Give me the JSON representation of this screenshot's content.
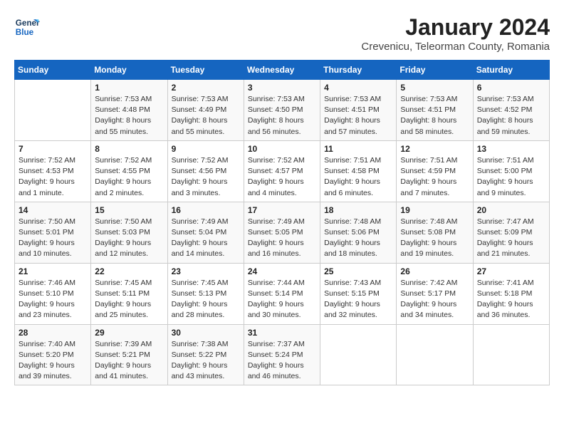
{
  "logo": {
    "line1": "General",
    "line2": "Blue"
  },
  "title": "January 2024",
  "subtitle": "Crevenicu, Teleorman County, Romania",
  "days_header": [
    "Sunday",
    "Monday",
    "Tuesday",
    "Wednesday",
    "Thursday",
    "Friday",
    "Saturday"
  ],
  "weeks": [
    [
      {
        "day": "",
        "info": ""
      },
      {
        "day": "1",
        "info": "Sunrise: 7:53 AM\nSunset: 4:48 PM\nDaylight: 8 hours\nand 55 minutes."
      },
      {
        "day": "2",
        "info": "Sunrise: 7:53 AM\nSunset: 4:49 PM\nDaylight: 8 hours\nand 55 minutes."
      },
      {
        "day": "3",
        "info": "Sunrise: 7:53 AM\nSunset: 4:50 PM\nDaylight: 8 hours\nand 56 minutes."
      },
      {
        "day": "4",
        "info": "Sunrise: 7:53 AM\nSunset: 4:51 PM\nDaylight: 8 hours\nand 57 minutes."
      },
      {
        "day": "5",
        "info": "Sunrise: 7:53 AM\nSunset: 4:51 PM\nDaylight: 8 hours\nand 58 minutes."
      },
      {
        "day": "6",
        "info": "Sunrise: 7:53 AM\nSunset: 4:52 PM\nDaylight: 8 hours\nand 59 minutes."
      }
    ],
    [
      {
        "day": "7",
        "info": "Sunrise: 7:52 AM\nSunset: 4:53 PM\nDaylight: 9 hours\nand 1 minute."
      },
      {
        "day": "8",
        "info": "Sunrise: 7:52 AM\nSunset: 4:55 PM\nDaylight: 9 hours\nand 2 minutes."
      },
      {
        "day": "9",
        "info": "Sunrise: 7:52 AM\nSunset: 4:56 PM\nDaylight: 9 hours\nand 3 minutes."
      },
      {
        "day": "10",
        "info": "Sunrise: 7:52 AM\nSunset: 4:57 PM\nDaylight: 9 hours\nand 4 minutes."
      },
      {
        "day": "11",
        "info": "Sunrise: 7:51 AM\nSunset: 4:58 PM\nDaylight: 9 hours\nand 6 minutes."
      },
      {
        "day": "12",
        "info": "Sunrise: 7:51 AM\nSunset: 4:59 PM\nDaylight: 9 hours\nand 7 minutes."
      },
      {
        "day": "13",
        "info": "Sunrise: 7:51 AM\nSunset: 5:00 PM\nDaylight: 9 hours\nand 9 minutes."
      }
    ],
    [
      {
        "day": "14",
        "info": "Sunrise: 7:50 AM\nSunset: 5:01 PM\nDaylight: 9 hours\nand 10 minutes."
      },
      {
        "day": "15",
        "info": "Sunrise: 7:50 AM\nSunset: 5:03 PM\nDaylight: 9 hours\nand 12 minutes."
      },
      {
        "day": "16",
        "info": "Sunrise: 7:49 AM\nSunset: 5:04 PM\nDaylight: 9 hours\nand 14 minutes."
      },
      {
        "day": "17",
        "info": "Sunrise: 7:49 AM\nSunset: 5:05 PM\nDaylight: 9 hours\nand 16 minutes."
      },
      {
        "day": "18",
        "info": "Sunrise: 7:48 AM\nSunset: 5:06 PM\nDaylight: 9 hours\nand 18 minutes."
      },
      {
        "day": "19",
        "info": "Sunrise: 7:48 AM\nSunset: 5:08 PM\nDaylight: 9 hours\nand 19 minutes."
      },
      {
        "day": "20",
        "info": "Sunrise: 7:47 AM\nSunset: 5:09 PM\nDaylight: 9 hours\nand 21 minutes."
      }
    ],
    [
      {
        "day": "21",
        "info": "Sunrise: 7:46 AM\nSunset: 5:10 PM\nDaylight: 9 hours\nand 23 minutes."
      },
      {
        "day": "22",
        "info": "Sunrise: 7:45 AM\nSunset: 5:11 PM\nDaylight: 9 hours\nand 25 minutes."
      },
      {
        "day": "23",
        "info": "Sunrise: 7:45 AM\nSunset: 5:13 PM\nDaylight: 9 hours\nand 28 minutes."
      },
      {
        "day": "24",
        "info": "Sunrise: 7:44 AM\nSunset: 5:14 PM\nDaylight: 9 hours\nand 30 minutes."
      },
      {
        "day": "25",
        "info": "Sunrise: 7:43 AM\nSunset: 5:15 PM\nDaylight: 9 hours\nand 32 minutes."
      },
      {
        "day": "26",
        "info": "Sunrise: 7:42 AM\nSunset: 5:17 PM\nDaylight: 9 hours\nand 34 minutes."
      },
      {
        "day": "27",
        "info": "Sunrise: 7:41 AM\nSunset: 5:18 PM\nDaylight: 9 hours\nand 36 minutes."
      }
    ],
    [
      {
        "day": "28",
        "info": "Sunrise: 7:40 AM\nSunset: 5:20 PM\nDaylight: 9 hours\nand 39 minutes."
      },
      {
        "day": "29",
        "info": "Sunrise: 7:39 AM\nSunset: 5:21 PM\nDaylight: 9 hours\nand 41 minutes."
      },
      {
        "day": "30",
        "info": "Sunrise: 7:38 AM\nSunset: 5:22 PM\nDaylight: 9 hours\nand 43 minutes."
      },
      {
        "day": "31",
        "info": "Sunrise: 7:37 AM\nSunset: 5:24 PM\nDaylight: 9 hours\nand 46 minutes."
      },
      {
        "day": "",
        "info": ""
      },
      {
        "day": "",
        "info": ""
      },
      {
        "day": "",
        "info": ""
      }
    ]
  ]
}
